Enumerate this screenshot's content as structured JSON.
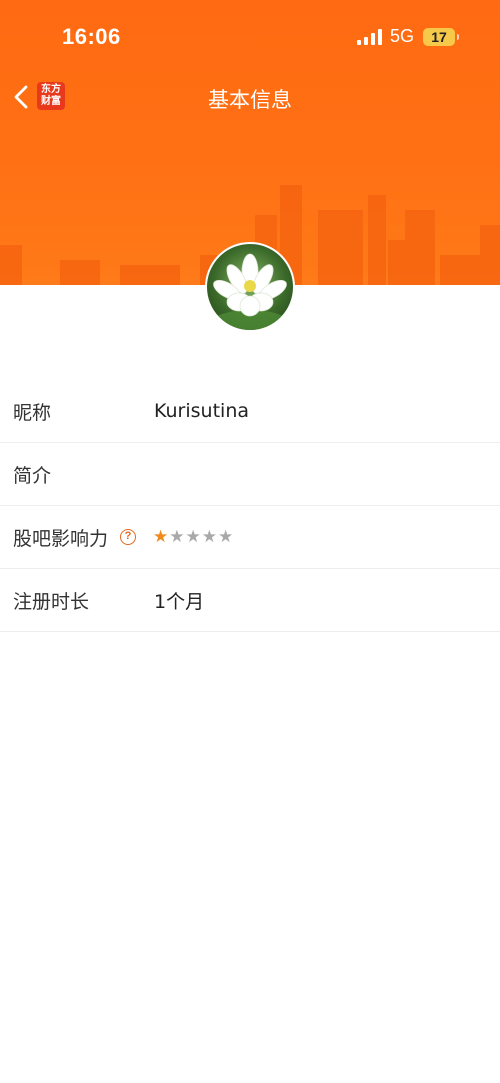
{
  "status_bar": {
    "time": "16:06",
    "network": "5G",
    "battery": "17"
  },
  "nav": {
    "brand_line1": "东方",
    "brand_line2": "财富",
    "title": "基本信息"
  },
  "colors": {
    "header_orange": "#ff6a12",
    "accent_star": "#f08a1c",
    "help_icon": "#e06a1f"
  },
  "profile": {
    "rows": [
      {
        "label": "昵称",
        "value": "Kurisutina"
      },
      {
        "label": "简介",
        "value": ""
      },
      {
        "label": "股吧影响力",
        "help_icon": "?",
        "rating": 1,
        "rating_max": 5,
        "stars": [
          "★",
          "★",
          "★",
          "★",
          "★"
        ]
      },
      {
        "label": "注册时长",
        "value": "1个月"
      }
    ]
  }
}
